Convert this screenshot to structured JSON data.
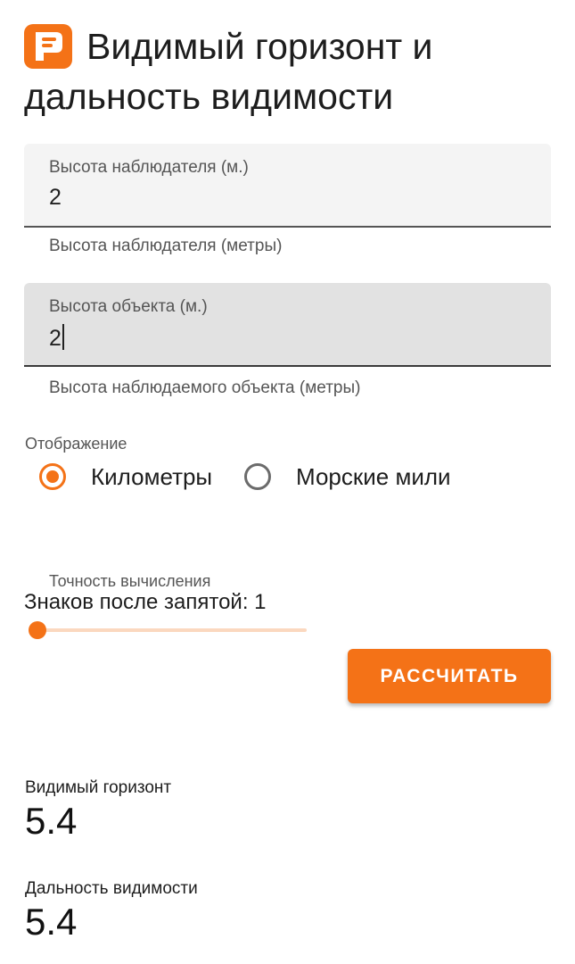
{
  "header": {
    "title": "Видимый горизонт и дальность видимости",
    "icon": "app-logo-icon",
    "accent_color": "#f47217"
  },
  "observer_height": {
    "label": "Высота наблюдателя (м.)",
    "value": "2",
    "helper": "Высота наблюдателя (метры)"
  },
  "object_height": {
    "label": "Высота объекта (м.)",
    "value": "2",
    "helper": "Высота наблюдаемого объекта (метры)",
    "focused": true
  },
  "display": {
    "legend": "Отображение",
    "options": [
      {
        "label": "Километры",
        "checked": true
      },
      {
        "label": "Морские мили",
        "checked": false
      }
    ]
  },
  "precision": {
    "label": "Точность вычисления",
    "value_text": "Знаков после запятой: 1",
    "slider_fraction": 0.03
  },
  "calculate_button": {
    "label": "РАССЧИТАТЬ"
  },
  "results": {
    "horizon": {
      "label": "Видимый горизонт",
      "value": "5.4"
    },
    "visibility": {
      "label": "Дальность видимости",
      "value": "5.4"
    }
  }
}
